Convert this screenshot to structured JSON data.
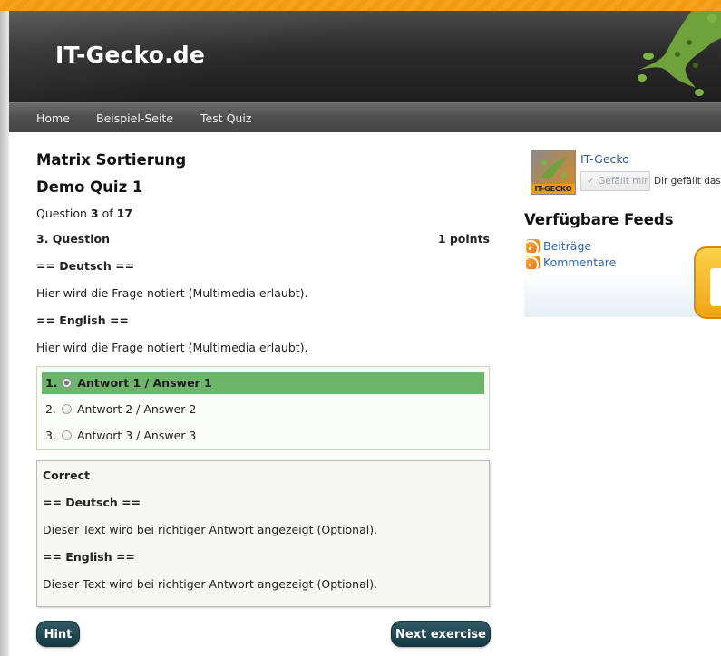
{
  "header": {
    "site_title": "IT-Gecko.de"
  },
  "nav": {
    "items": [
      "Home",
      "Beispiel-Seite",
      "Test Quiz"
    ]
  },
  "quiz": {
    "title": "Matrix Sortierung",
    "subtitle": "Demo Quiz 1",
    "counter_prefix": "Question",
    "counter_current": "3",
    "counter_of": "of",
    "counter_total": "17",
    "question_label": "3. Question",
    "points": "1 points",
    "lines": [
      "== Deutsch ==",
      "Hier wird die Frage notiert (Multimedia erlaubt).",
      "== English ==",
      "Hier wird die Frage notiert (Multimedia erlaubt)."
    ],
    "answers": [
      {
        "num": "1.",
        "label": "Antwort 1 / Answer 1",
        "selected": true
      },
      {
        "num": "2.",
        "label": "Antwort 2 / Answer 2",
        "selected": false
      },
      {
        "num": "3.",
        "label": "Antwort 3 / Answer 3",
        "selected": false
      }
    ],
    "feedback": {
      "heading": "Correct",
      "lines": [
        "== Deutsch ==",
        "Dieser Text wird bei richtiger Antwort angezeigt (Optional).",
        "== English ==",
        "Dieser Text wird bei richtiger Antwort angezeigt (Optional)."
      ]
    },
    "hint_label": "Hint",
    "next_label": "Next exercise"
  },
  "sidebar": {
    "fb_name": "IT-Gecko",
    "fb_thumb_caption": "IT-GECKO",
    "fb_like_label": "✓ Gefällt mir",
    "fb_like_text": "Dir gefällt das.",
    "feeds_title": "Verfügbare Feeds",
    "feeds": [
      "Beiträge",
      "Kommentare"
    ]
  },
  "colors": {
    "accent_orange": "#f29a12",
    "header_dark": "#2b2b2b",
    "selected_answer": "#6db56b",
    "button": "#1f4651"
  }
}
